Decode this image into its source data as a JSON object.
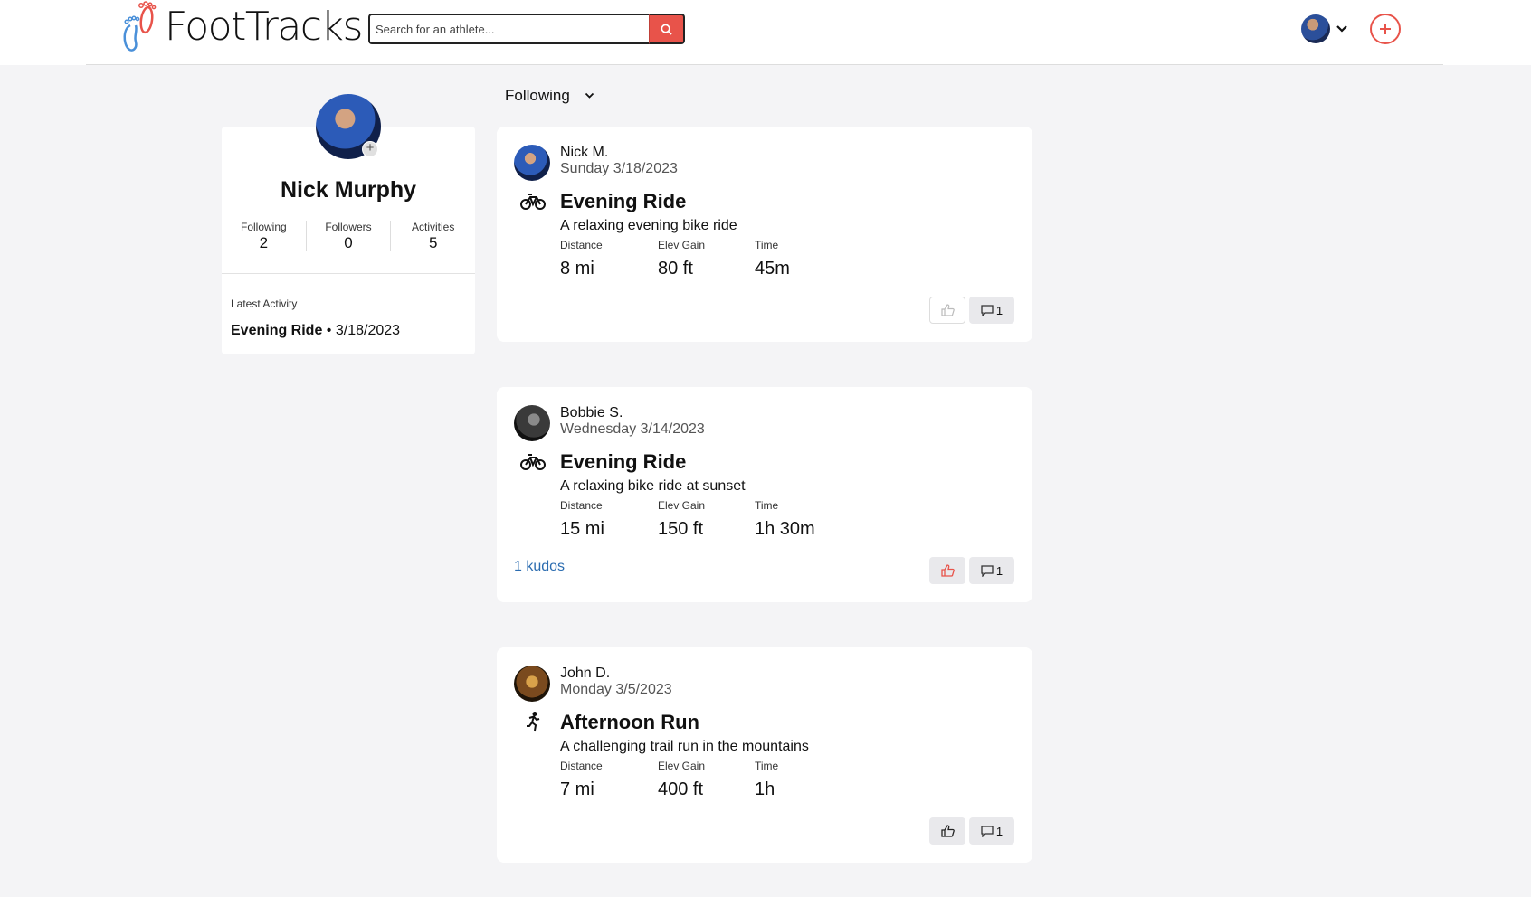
{
  "header": {
    "logo_text": "FootTracks",
    "search_placeholder": "Search for an athlete...",
    "brand_color": "#e8534a"
  },
  "profile": {
    "name": "Nick Murphy",
    "stats": [
      {
        "label": "Following",
        "value": "2"
      },
      {
        "label": "Followers",
        "value": "0"
      },
      {
        "label": "Activities",
        "value": "5"
      }
    ],
    "latest_label": "Latest Activity",
    "latest_title": "Evening Ride",
    "latest_date": " • 3/18/2023"
  },
  "feed": {
    "filter_label": "Following",
    "activities": [
      {
        "user": "Nick M.",
        "date": "Sunday 3/18/2023",
        "type": "bike-icon",
        "title": "Evening Ride",
        "description": "A relaxing evening bike ride",
        "metrics": [
          {
            "label": "Distance",
            "value": "8 mi"
          },
          {
            "label": "Elev Gain",
            "value": "80 ft"
          },
          {
            "label": "Time",
            "value": "45m"
          }
        ],
        "kudos_text": "",
        "comment_count": "1"
      },
      {
        "user": "Bobbie S.",
        "date": "Wednesday 3/14/2023",
        "type": "bike-icon",
        "title": "Evening Ride",
        "description": "A relaxing bike ride at sunset",
        "metrics": [
          {
            "label": "Distance",
            "value": "15 mi"
          },
          {
            "label": "Elev Gain",
            "value": "150 ft"
          },
          {
            "label": "Time",
            "value": "1h 30m"
          }
        ],
        "kudos_text": "1 kudos",
        "comment_count": "1"
      },
      {
        "user": "John D.",
        "date": "Monday 3/5/2023",
        "type": "run-icon",
        "title": "Afternoon Run",
        "description": "A challenging trail run in the mountains",
        "metrics": [
          {
            "label": "Distance",
            "value": "7 mi"
          },
          {
            "label": "Elev Gain",
            "value": "400 ft"
          },
          {
            "label": "Time",
            "value": "1h"
          }
        ],
        "kudos_text": "",
        "comment_count": "1"
      }
    ]
  }
}
